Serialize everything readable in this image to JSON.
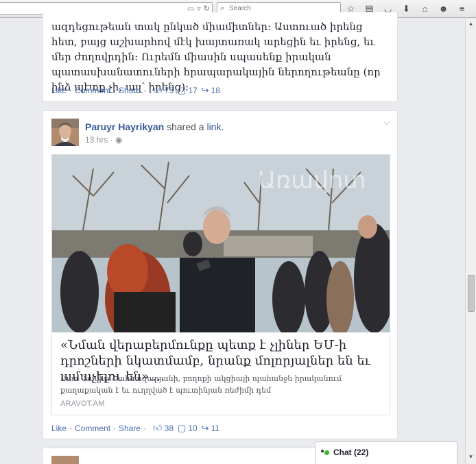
{
  "browser": {
    "search_placeholder": "Search",
    "icons": [
      "bookmark-star-icon",
      "reading-list-icon",
      "pocket-icon",
      "download-icon",
      "home-icon",
      "chat-bubble-icon",
      "menu-icon"
    ]
  },
  "post1": {
    "text": "ազդեցութեան տակ ընկած միամիտներ: Աստուած իրենց հետ, բայց աշխարհով մէկ խայտառակ արեցին եւ իրենց, եւ մեր ժողովրդին: Ուրեմն միասին սպասենք իրական պատասխանատուների հրապարակային ներողութեանը (որ ինձ պէտք չի, այլ՝ իրենց):",
    "actions": {
      "like": "Like",
      "comment": "Comment",
      "share": "Share"
    },
    "likes": "75",
    "comments": "17",
    "shares": "18"
  },
  "post2": {
    "author": "Paruyr Hayrikyan",
    "verb": "shared a",
    "object": "link",
    "period": ".",
    "time": "13 hrs",
    "time_sep": "·",
    "link": {
      "image_watermark": "Առավոտ",
      "title": "«Նման վերաբերմունքը պետք է չլիներ ԵՄ-ի դրոշների նկատմամբ, նրանք մոլորյալներ են եւ ամաչելու են»....",
      "description": "Ըստ Դավիթ Շահնազարյանի, բողոքի ակցիայի պահանջն իրականում քաղաքական է եւ ուղղված է պուտինյան ռեժիմի դեմ",
      "domain": "ARAVOT.AM"
    },
    "actions": {
      "like": "Like",
      "comment": "Comment",
      "share": "Share"
    },
    "likes": "38",
    "comments": "10",
    "shares": "11"
  },
  "chat": {
    "label": "Chat (22)"
  },
  "colors": {
    "link_blue": "#365899",
    "action_blue": "#4b6db2",
    "online_green": "#42b72a",
    "feed_bg": "#e9ebee"
  }
}
